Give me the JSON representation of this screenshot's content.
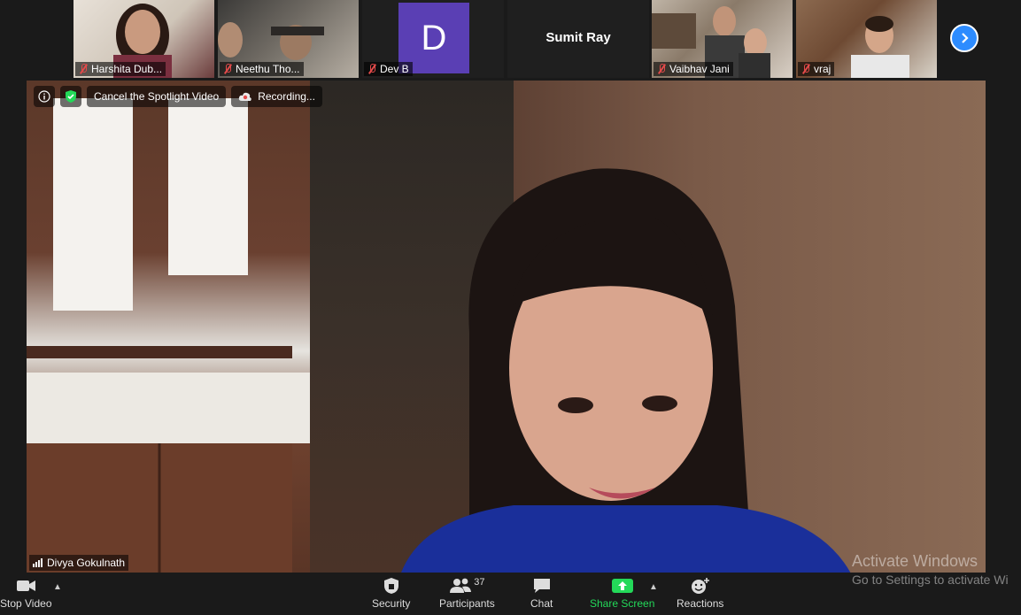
{
  "gallery": {
    "participants": [
      {
        "name": "Harshita Dub...",
        "muted": true
      },
      {
        "name": "Neethu Tho...",
        "muted": true
      },
      {
        "name": "Dev B",
        "initial": "D",
        "muted": true
      },
      {
        "name": "Sumit Ray",
        "muted": false
      },
      {
        "name": "Vaibhav Jani",
        "muted": true
      },
      {
        "name": "vraj",
        "muted": true
      }
    ],
    "next_icon": "chevron-right-icon"
  },
  "spotlight": {
    "cancel_label": "Cancel the Spotlight Video",
    "recording_label": "Recording...",
    "speaker_name": "Divya Gokulnath"
  },
  "toolbar": {
    "stop_video": "Stop Video",
    "security": "Security",
    "participants": "Participants",
    "participants_count": "37",
    "chat": "Chat",
    "share_screen": "Share Screen",
    "reactions": "Reactions"
  },
  "watermark": {
    "line1": "Activate Windows",
    "line2": "Go to Settings to activate Wi"
  },
  "colors": {
    "accent": "#2d8cff",
    "share": "#23d959",
    "mute": "#e34a4a",
    "avatar": "#5a3fb4"
  }
}
